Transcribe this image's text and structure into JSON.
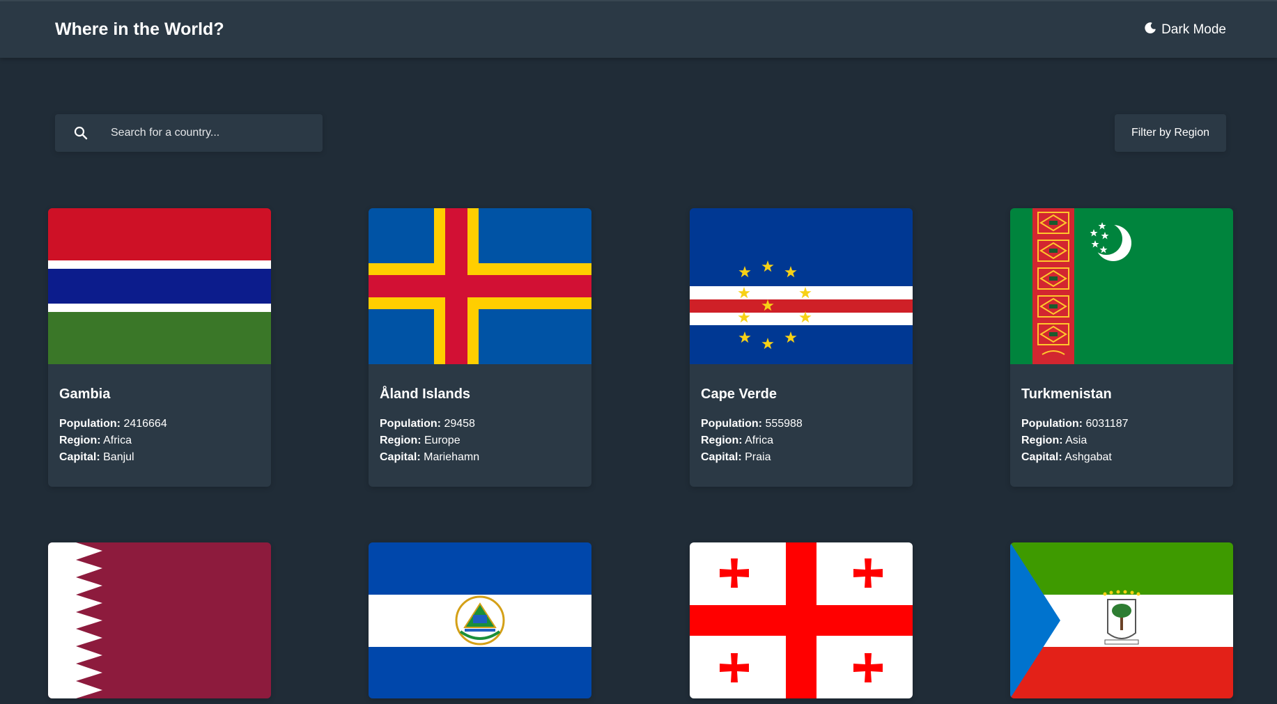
{
  "header": {
    "title": "Where in the World?",
    "theme_label": "Dark Mode",
    "theme_icon": "moon-icon"
  },
  "search": {
    "placeholder": "Search for a country...",
    "icon": "search-icon"
  },
  "filter": {
    "label": "Filter by Region"
  },
  "labels": {
    "population": "Population:",
    "region": "Region:",
    "capital": "Capital:"
  },
  "countries": [
    {
      "name": "Gambia",
      "population": "2416664",
      "region": "Africa",
      "capital": "Banjul",
      "flag": "gambia-flag"
    },
    {
      "name": "Åland Islands",
      "population": "29458",
      "region": "Europe",
      "capital": "Mariehamn",
      "flag": "aland-flag"
    },
    {
      "name": "Cape Verde",
      "population": "555988",
      "region": "Africa",
      "capital": "Praia",
      "flag": "cape-verde-flag"
    },
    {
      "name": "Turkmenistan",
      "population": "6031187",
      "region": "Asia",
      "capital": "Ashgabat",
      "flag": "turkmenistan-flag"
    },
    {
      "flag": "qatar-flag"
    },
    {
      "flag": "el-salvador-flag"
    },
    {
      "flag": "georgia-flag"
    },
    {
      "flag": "equatorial-guinea-flag"
    }
  ],
  "colors": {
    "background": "#202c37",
    "surface": "#2b3945",
    "text": "#ffffff"
  }
}
